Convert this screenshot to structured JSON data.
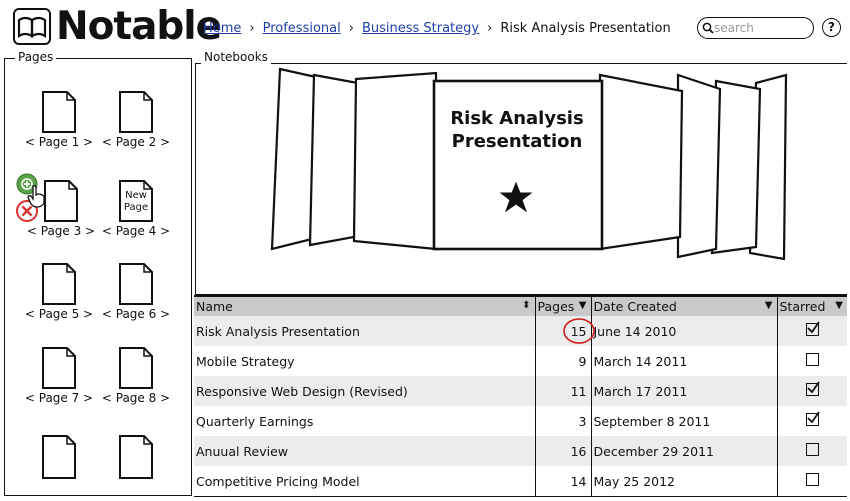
{
  "app": {
    "title": "Notable"
  },
  "breadcrumb": {
    "items": [
      "Home",
      "Professional",
      "Business Strategy"
    ],
    "current": "Risk Analysis Presentation",
    "separator": "›"
  },
  "search": {
    "placeholder": "search"
  },
  "help": {
    "label": "?"
  },
  "pages_panel": {
    "title": "Pages",
    "items": [
      {
        "label": "< Page 1 >"
      },
      {
        "label": "< Page 2 >"
      },
      {
        "label": "< Page 3 >"
      },
      {
        "label": "< Page 4 >"
      },
      {
        "label": "< Page 5 >"
      },
      {
        "label": "< Page 6 >"
      },
      {
        "label": "< Page 7 >"
      },
      {
        "label": "< Page 8 >"
      }
    ],
    "new_page_text": "New Page"
  },
  "notebooks_panel": {
    "title": "Notebooks",
    "featured": "Risk Analysis Presentation"
  },
  "table": {
    "columns": [
      "Name",
      "Pages",
      "Date Created",
      "Starred"
    ],
    "rows": [
      {
        "name": "Risk Analysis Presentation",
        "pages": "15",
        "date": "June 14 2010",
        "starred": true
      },
      {
        "name": "Mobile Strategy",
        "pages": "9",
        "date": "March 14 2011",
        "starred": false
      },
      {
        "name": "Responsive Web Design (Revised)",
        "pages": "11",
        "date": "March 17 2011",
        "starred": true
      },
      {
        "name": "Quarterly Earnings",
        "pages": "3",
        "date": "September 8 2011",
        "starred": true
      },
      {
        "name": "Anuual Review",
        "pages": "16",
        "date": "December 29 2011",
        "starred": false
      },
      {
        "name": "Competitive Pricing Model",
        "pages": "14",
        "date": "May 25 2012",
        "starred": false
      }
    ]
  },
  "colors": {
    "link": "#1f3fa8",
    "header_bg": "#c9c9c9",
    "row_alt": "#ececec",
    "highlight": "#d11a1a",
    "add": "#5aa34a",
    "remove": "#d33"
  }
}
